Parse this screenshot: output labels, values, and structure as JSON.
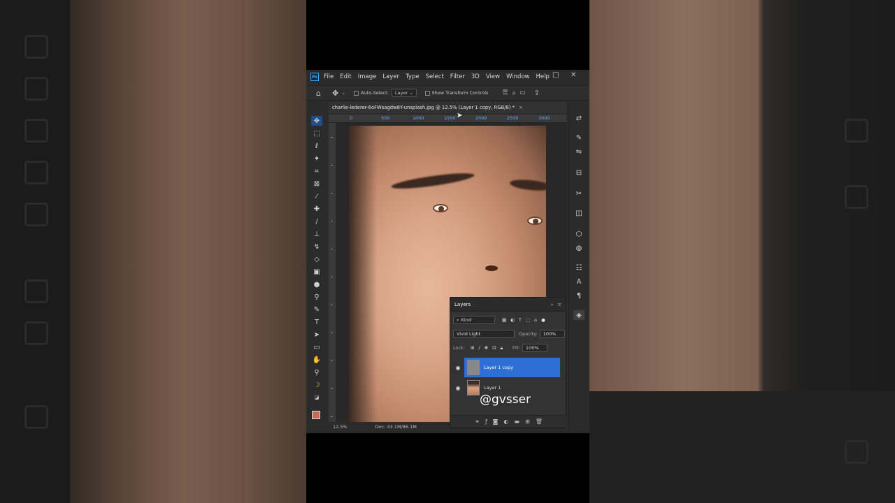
{
  "app": {
    "logo": "Ps",
    "menus": [
      "File",
      "Edit",
      "Image",
      "Layer",
      "Type",
      "Select",
      "Filter",
      "3D",
      "View",
      "Window",
      "Help"
    ]
  },
  "options": {
    "auto_select_label": "Auto-Select:",
    "layer_dropdown": "Layer",
    "show_transform_label": "Show Transform Controls"
  },
  "document": {
    "tab_title": "charlie-lederer-6oFWsagdw8Y-unsplash.jpg @ 12.5% (Layer 1 copy, RGB/8) *",
    "close_glyph": "×",
    "ruler_marks": [
      "0",
      "500",
      "1000",
      "1500",
      "2000",
      "2500",
      "3000"
    ],
    "zoom": "12.5%",
    "doc_info": "Doc: 43.1M/86.1M"
  },
  "layers_panel": {
    "title": "Layers",
    "filter_kind": "Kind",
    "blend_mode": "Vivid Light",
    "opacity_label": "Opacity:",
    "opacity_value": "100%",
    "lock_label": "Lock:",
    "fill_label": "Fill:",
    "fill_value": "100%",
    "layers": [
      {
        "name": "Layer 1 copy",
        "selected": true
      },
      {
        "name": "Layer 1",
        "selected": false
      }
    ],
    "watermark": "@gvsser"
  },
  "colors": {
    "accent": "#2d6fd4",
    "foreground_swatch": "#c46a58"
  }
}
